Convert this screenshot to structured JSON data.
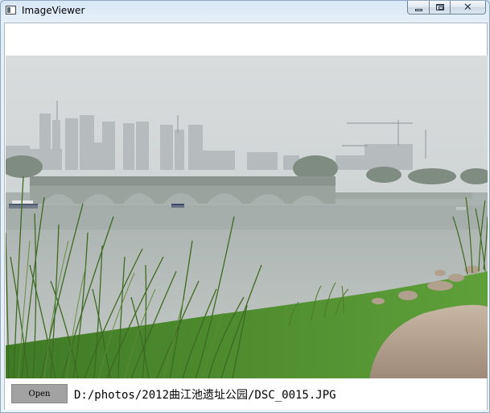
{
  "window": {
    "title": "ImageViewer",
    "icon": "app-window-icon"
  },
  "titlebar_buttons": {
    "minimize": "minimize-icon",
    "maximize": "maximize-icon",
    "close": "close-icon"
  },
  "toolbar": {
    "open_label": "Open",
    "file_path": "D:/photos/2012曲江池遗址公园/DSC_0015.JPG"
  },
  "image": {
    "subject": "lake-with-arched-bridge-city-skyline-reeds-grass",
    "colors": {
      "sky": "#d4d8d9",
      "water": "#b9c0bd",
      "grass": "#4f8f2c",
      "bridge": "#8e9693"
    }
  }
}
